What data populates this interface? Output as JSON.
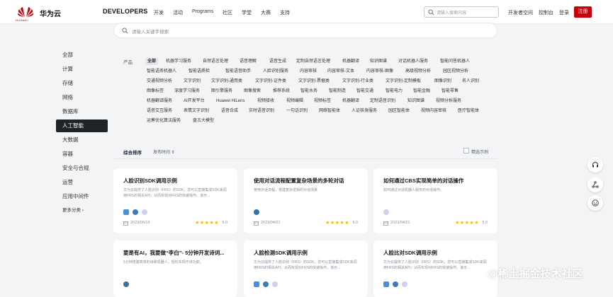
{
  "header": {
    "brand": "华为云",
    "logo_sub": "HUAWEI",
    "developers": "DEVELOPERS",
    "nav": [
      "开发",
      "活动",
      "Programs",
      "社区",
      "学堂",
      "大赛",
      "支持"
    ],
    "search_placeholder": "请输入搜索内容",
    "links": [
      "开发者空间",
      "控制台",
      "登录"
    ],
    "register": "注册",
    "accent": "#c7000b"
  },
  "main_search": {
    "placeholder": "请输入关键字搜索"
  },
  "sidebar": {
    "items": [
      "全部",
      "计算",
      "存储",
      "网络",
      "数据库",
      "人工智能",
      "大数据",
      "容器",
      "安全与合规",
      "运营",
      "应用中间件",
      "更多分类 ›"
    ],
    "active": "人工智能"
  },
  "filters": {
    "label": "产品",
    "rows": [
      [
        "全部",
        "机器学习服务",
        "自然语言处理",
        "语音理解",
        "语音生成",
        "定制自然语言处理",
        "机器翻译",
        "知识图谱",
        "对话机器人服务",
        "智能问答机器人"
      ],
      [
        "智能语务机器人",
        "智能语质检",
        "智能语音助手",
        "人脸识别服务",
        "内容审核",
        "内容审核-文本",
        "内容审核-图像",
        "高级视频分析",
        "园区视频分析"
      ],
      [
        "交通视频分析",
        "文字识别",
        "文字识别-通用类",
        "文字识别-证件类",
        "文字识别-票据类",
        "文字识别-行业类",
        "文字识别-定制模板",
        "图像识别",
        "名人识别"
      ],
      [
        "图像标签",
        "深度学习服务",
        "图引擎服务",
        "图像搜索",
        "推荐系统",
        "智能水务",
        "智能制造",
        "智能交通",
        "智能电力",
        "智能金融",
        "智能零售"
      ],
      [
        "机器翻译服务",
        "AI开发平台",
        "Huawei HiLens",
        "视频接收",
        "视频编辑",
        "视频标签",
        "机器翻译",
        "定制语音识别",
        "知识图谱",
        "视频分析服务"
      ],
      [
        "语音交互服务",
        "表情文字识别",
        "语音合成",
        "实时语音识别",
        "一句话识别",
        "网络智能体",
        "人证核身服务",
        "园区智能体",
        "视频内容审核",
        "医疗智能体"
      ],
      [
        "运筹优化算法服务",
        "盘古大模型"
      ]
    ],
    "active": "全部"
  },
  "sort": {
    "comprehensive": "综合排序",
    "time": "发布时间 ⇕",
    "featured": "精选示例"
  },
  "cards": [
    {
      "title": "人脸识别SDK调用示例",
      "desc": "华为云提供了人脸识别（FRS）的SDK，您可以直接集成SDK来调用FRS的相关API，从而实现对FRS的快速操作。该示...",
      "date": "2023/06/19",
      "score": "5.0",
      "stars": "★★★★★",
      "icons": [
        "#4a90d9",
        "#3d7ab8",
        "#cdd2ec"
      ]
    },
    {
      "title": "使用对话流程配置复杂场景的多轮对话",
      "desc": "使用对话流程，搭建复杂逻辑的对话场景",
      "date": "2023/04/21",
      "score": "5.0",
      "stars": "★★★★★",
      "icons": [
        "#3572a5"
      ]
    },
    {
      "title": "如何通过CBS实现简单的对话操作",
      "desc": "如何通过对话机器人服务的对话操作。",
      "date": "2023/04/21",
      "score": "5.0",
      "stars": "★★★★★",
      "icons": [
        "#cdd2ec"
      ]
    },
    {
      "title": "要是有AI，我要做“李白”- 5分钟开发诗词...",
      "desc": "5分钟搭建简单的诗歌机器人，轻松实现作诗功能。",
      "date": "",
      "score": "",
      "stars": "",
      "icons": [
        "#3572a5"
      ]
    },
    {
      "title": "人脸检测SDK调用示例",
      "desc": "华为云提供了人脸识别（FRS）的SDK，您可以直接集成SDK来调用FRS的相关API，从而实现对FRS的快速操作。该示...",
      "date": "",
      "score": "",
      "stars": "",
      "icons": [
        "#4a90d9",
        "#3d7ab8",
        "#cdd2ec"
      ]
    },
    {
      "title": "人脸比对SDK调用示例",
      "desc": "华为云提供了人脸识别（FRS）的SDK，您可以直接集成SDK来调用FRS的相关API，从而实现对FRS的快速操作。该示...",
      "date": "",
      "score": "",
      "stars": "",
      "icons": [
        "#4a90d9",
        "#3d7ab8",
        "#cdd2ec"
      ]
    }
  ],
  "float_buttons": [
    "headset-icon",
    "share-icon",
    "smiley-icon"
  ],
  "watermark": "@稀土掘金技术社区"
}
